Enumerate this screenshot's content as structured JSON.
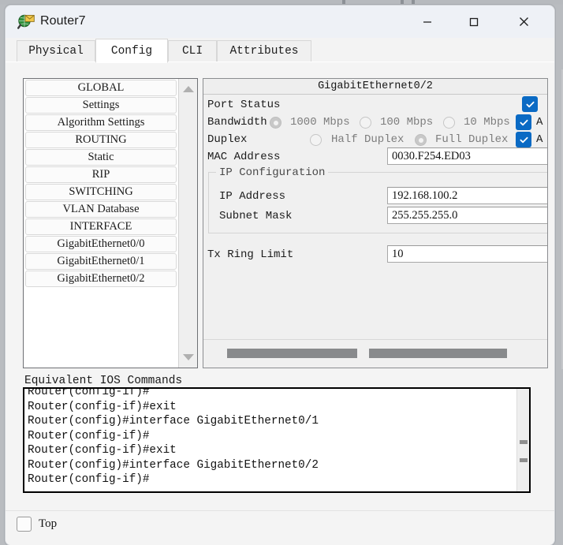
{
  "window": {
    "title": "Router7",
    "icon": "router-inspect-icon",
    "controls": {
      "minimize": "minimize-icon",
      "maximize": "maximize-icon",
      "close": "close-icon"
    }
  },
  "tabs": [
    {
      "label": "Physical",
      "active": false
    },
    {
      "label": "Config",
      "active": true
    },
    {
      "label": "CLI",
      "active": false
    },
    {
      "label": "Attributes",
      "active": false
    }
  ],
  "sidebar": {
    "items": [
      {
        "label": "GLOBAL"
      },
      {
        "label": "Settings"
      },
      {
        "label": "Algorithm Settings"
      },
      {
        "label": "ROUTING"
      },
      {
        "label": "Static"
      },
      {
        "label": "RIP"
      },
      {
        "label": "SWITCHING"
      },
      {
        "label": "VLAN Database"
      },
      {
        "label": "INTERFACE"
      },
      {
        "label": "GigabitEthernet0/0"
      },
      {
        "label": "GigabitEthernet0/1"
      },
      {
        "label": "GigabitEthernet0/2"
      }
    ],
    "scroll_up": "scroll-up-arrow-icon",
    "scroll_down": "scroll-down-arrow-icon"
  },
  "config": {
    "header": "GigabitEthernet0/2",
    "port_status": {
      "label": "Port Status",
      "checkbox_state": "checked",
      "checkbox_label": ""
    },
    "bandwidth": {
      "label": "Bandwidth",
      "options": [
        {
          "label": "1000 Mbps",
          "selected": true
        },
        {
          "label": "100 Mbps",
          "selected": false
        },
        {
          "label": "10 Mbps",
          "selected": false
        }
      ],
      "auto_label": "A",
      "auto_checked": true
    },
    "duplex": {
      "label": "Duplex",
      "options": [
        {
          "label": "Half Duplex",
          "selected": false
        },
        {
          "label": "Full Duplex",
          "selected": true
        }
      ],
      "auto_label": "A",
      "auto_checked": true
    },
    "mac": {
      "label": "MAC Address",
      "value": "0030.F254.ED03"
    },
    "ip_configuration": {
      "title": "IP Configuration",
      "ip_address": {
        "label": "IP Address",
        "value": "192.168.100.2"
      },
      "subnet_mask": {
        "label": "Subnet Mask",
        "value": "255.255.255.0"
      }
    },
    "tx_ring_limit": {
      "label": "Tx Ring Limit",
      "value": "10"
    }
  },
  "ios": {
    "title": "Equivalent IOS Commands",
    "lines": "Router(config-if)#\nRouter(config-if)#exit\nRouter(config)#interface GigabitEthernet0/1\nRouter(config-if)#\nRouter(config-if)#exit\nRouter(config)#interface GigabitEthernet0/2\nRouter(config-if)#"
  },
  "bottom": {
    "top_checkbox_label": "Top",
    "top_checkbox_checked": false
  },
  "colors": {
    "checkbox_accent": "#0a6ac4",
    "window_bg": "#f3f3f3",
    "panel_bg": "#f0f0f0",
    "desktop_bg": "#b9bcc0"
  }
}
